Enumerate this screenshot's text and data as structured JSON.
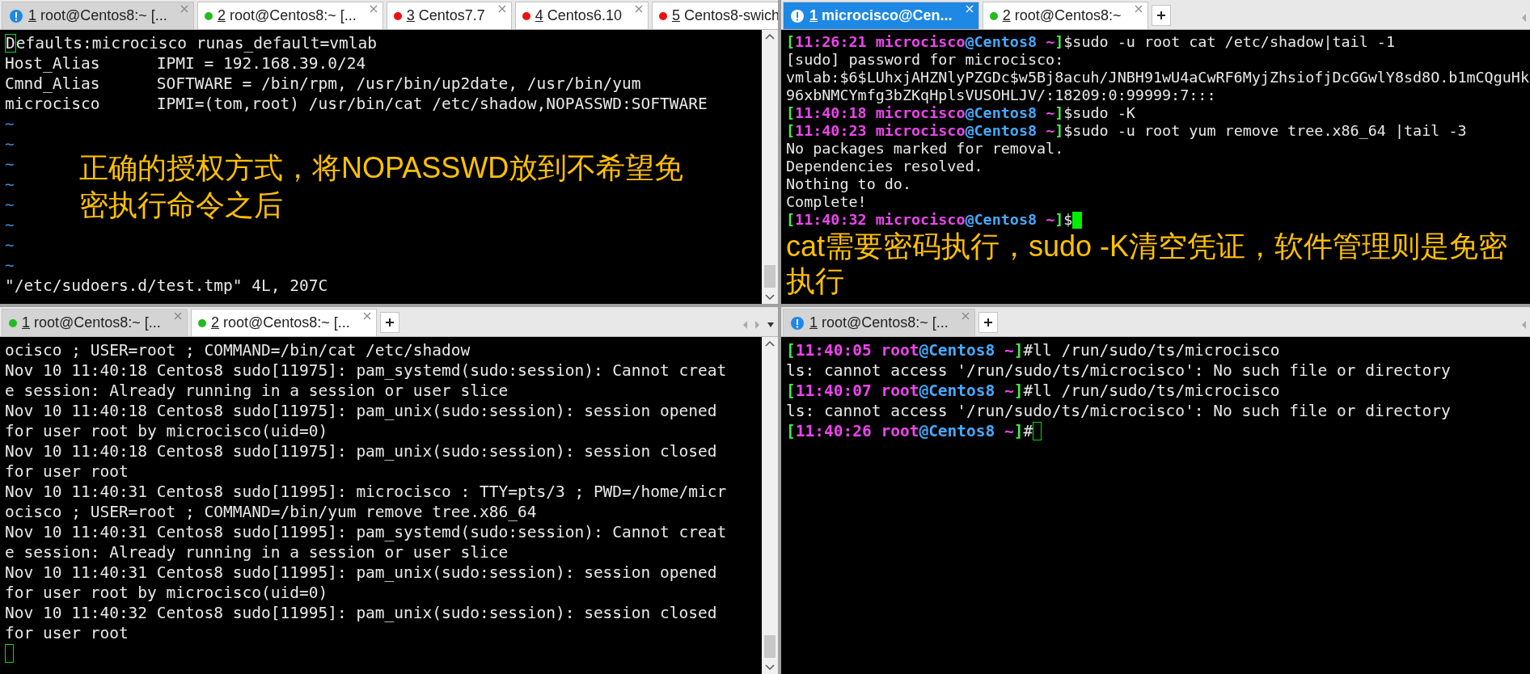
{
  "panes": [
    {
      "focused": false,
      "scrollbar": true,
      "tabs": [
        {
          "kind": "alert",
          "number": "1",
          "label": "root@Centos8:~ [...",
          "selected": true,
          "closable": true
        },
        {
          "kind": "dot",
          "color": "#22bb22",
          "number": "2",
          "label": "root@Centos8:~ [...",
          "selected": false,
          "closable": true
        },
        {
          "kind": "dot",
          "color": "#ee1111",
          "number": "3",
          "label": "Centos7.7",
          "selected": false,
          "closable": true
        },
        {
          "kind": "dot",
          "color": "#ee1111",
          "number": "4",
          "label": "Centos6.10",
          "selected": false,
          "closable": true
        },
        {
          "kind": "dot",
          "color": "#ee1111",
          "number": "5",
          "label": "Centos8-swich",
          "selected": false,
          "closable": false
        }
      ],
      "lines": [
        {
          "kind": "text",
          "text": "Defaults:microcisco runas_default=vmlab",
          "cursor": true
        },
        {
          "kind": "text",
          "text": "Host_Alias      IPMI = 192.168.39.0/24"
        },
        {
          "kind": "text",
          "text": "Cmnd_Alias      SOFTWARE = /bin/rpm, /usr/bin/up2date, /usr/bin/yum"
        },
        {
          "kind": "text",
          "text": "microcisco      IPMI=(tom,root) /usr/bin/cat /etc/shadow,NOPASSWD:SOFTWARE"
        },
        {
          "kind": "tilde",
          "text": "~"
        },
        {
          "kind": "tilde",
          "text": "~"
        },
        {
          "kind": "tilde",
          "text": "~"
        },
        {
          "kind": "tilde",
          "text": "~"
        },
        {
          "kind": "tilde",
          "text": "~"
        },
        {
          "kind": "tilde",
          "text": "~"
        },
        {
          "kind": "tilde",
          "text": "~"
        },
        {
          "kind": "tilde",
          "text": "~"
        },
        {
          "kind": "text",
          "text": "\"/etc/sudoers.d/test.tmp\" 4L, 207C"
        }
      ],
      "note": "正确的授权方式，将NOPASSWD放到不希望免密执行命令之后"
    },
    {
      "focused": true,
      "scrollbar": false,
      "tabs": [
        {
          "kind": "alert",
          "number": "1",
          "label": "microcisco@Cen...",
          "selected": true,
          "closable": true
        },
        {
          "kind": "dot",
          "color": "#22bb22",
          "number": "2",
          "label": "root@Centos8:~",
          "selected": false,
          "closable": true
        }
      ],
      "lines": [
        {
          "kind": "prompt",
          "open": "[",
          "time": "11:26:21",
          "user": "microcisco",
          "host": "@Centos8",
          "dir": "~",
          "close": "]",
          "sign": "$",
          "command": "sudo -u root cat /etc/shadow|tail -1"
        },
        {
          "kind": "text",
          "text": "[sudo] password for microcisco:"
        },
        {
          "kind": "text",
          "text": "vmlab:$6$LUhxjAHZNlyPZGDc$w5Bj8acuh/JNBH91wU4aCwRF6MyjZhsiofjDcGGwlY8sd8O.b1mCQguHk"
        },
        {
          "kind": "text",
          "text": "96xbNMCYmfg3bZKqHplsVUSOHLJV/:18209:0:99999:7:::"
        },
        {
          "kind": "prompt",
          "open": "[",
          "time": "11:40:18",
          "user": "microcisco",
          "host": "@Centos8",
          "dir": "~",
          "close": "]",
          "sign": "$",
          "command": "sudo -K"
        },
        {
          "kind": "prompt",
          "open": "[",
          "time": "11:40:23",
          "user": "microcisco",
          "host": "@Centos8",
          "dir": "~",
          "close": "]",
          "sign": "$",
          "command": "sudo -u root yum remove tree.x86_64 |tail -3"
        },
        {
          "kind": "text",
          "text": "No packages marked for removal."
        },
        {
          "kind": "text",
          "text": "Dependencies resolved."
        },
        {
          "kind": "text",
          "text": "Nothing to do."
        },
        {
          "kind": "text",
          "text": "Complete!"
        },
        {
          "kind": "prompt",
          "open": "[",
          "time": "11:40:32",
          "user": "microcisco",
          "host": "@Centos8",
          "dir": "~",
          "close": "]",
          "sign": "$",
          "cursor": true
        },
        {
          "kind": "note",
          "text": "cat需要密码执行，sudo -K清空凭证，软件管理则是免密执行"
        }
      ]
    },
    {
      "focused": false,
      "scrollbar": true,
      "tabs": [
        {
          "kind": "dot",
          "color": "#22bb22",
          "number": "1",
          "label": "root@Centos8:~ [...",
          "selected": true,
          "closable": true
        },
        {
          "kind": "dot",
          "color": "#22bb22",
          "number": "2",
          "label": "root@Centos8:~ [...",
          "selected": false,
          "closable": true
        }
      ],
      "lines": [
        {
          "kind": "text",
          "text": "ocisco ; USER=root ; COMMAND=/bin/cat /etc/shadow"
        },
        {
          "kind": "text",
          "text": "Nov 10 11:40:18 Centos8 sudo[11975]: pam_systemd(sudo:session): Cannot creat"
        },
        {
          "kind": "text",
          "text": "e session: Already running in a session or user slice"
        },
        {
          "kind": "text",
          "text": "Nov 10 11:40:18 Centos8 sudo[11975]: pam_unix(sudo:session): session opened"
        },
        {
          "kind": "text",
          "text": "for user root by microcisco(uid=0)"
        },
        {
          "kind": "text",
          "text": "Nov 10 11:40:18 Centos8 sudo[11975]: pam_unix(sudo:session): session closed"
        },
        {
          "kind": "text",
          "text": "for user root"
        },
        {
          "kind": "text",
          "text": "Nov 10 11:40:31 Centos8 sudo[11995]: microcisco : TTY=pts/3 ; PWD=/home/micr"
        },
        {
          "kind": "text",
          "text": "ocisco ; USER=root ; COMMAND=/bin/yum remove tree.x86_64"
        },
        {
          "kind": "text",
          "text": "Nov 10 11:40:31 Centos8 sudo[11995]: pam_systemd(sudo:session): Cannot creat"
        },
        {
          "kind": "text",
          "text": "e session: Already running in a session or user slice"
        },
        {
          "kind": "text",
          "text": "Nov 10 11:40:31 Centos8 sudo[11995]: pam_unix(sudo:session): session opened"
        },
        {
          "kind": "text",
          "text": "for user root by microcisco(uid=0)"
        },
        {
          "kind": "text",
          "text": "Nov 10 11:40:32 Centos8 sudo[11995]: pam_unix(sudo:session): session closed"
        },
        {
          "kind": "text",
          "text": "for user root"
        },
        {
          "kind": "cursor"
        }
      ]
    },
    {
      "focused": false,
      "scrollbar": false,
      "tabs": [
        {
          "kind": "alert",
          "number": "1",
          "label": "root@Centos8:~ [...",
          "selected": true,
          "closable": true
        }
      ],
      "lines": [
        {
          "kind": "prompt",
          "open": "[",
          "time": "11:40:05",
          "user": "root",
          "host": "@Centos8",
          "dir": "~",
          "close": "]",
          "sign": "#",
          "command": "ll /run/sudo/ts/microcisco"
        },
        {
          "kind": "text",
          "text": "ls: cannot access '/run/sudo/ts/microcisco': No such file or directory"
        },
        {
          "kind": "prompt",
          "open": "[",
          "time": "11:40:07",
          "user": "root",
          "host": "@Centos8",
          "dir": "~",
          "close": "]",
          "sign": "#",
          "command": "ll /run/sudo/ts/microcisco"
        },
        {
          "kind": "text",
          "text": "ls: cannot access '/run/sudo/ts/microcisco': No such file or directory"
        },
        {
          "kind": "prompt",
          "open": "[",
          "time": "11:40:26",
          "user": "root",
          "host": "@Centos8",
          "dir": "~",
          "close": "]",
          "sign": "#",
          "cursor": true
        }
      ]
    }
  ]
}
